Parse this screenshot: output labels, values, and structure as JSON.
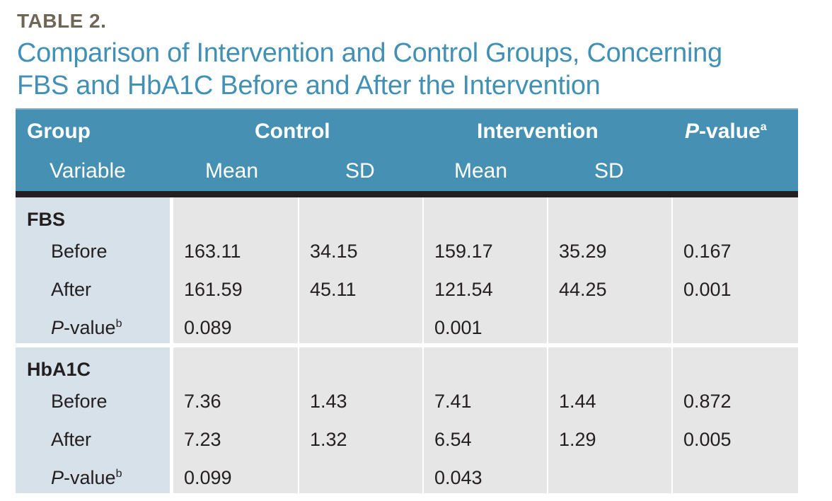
{
  "table_label": "TABLE 2.",
  "title": "Comparison of Intervention and Control Groups, Concerning FBS and HbA1C Before and After the Intervention",
  "header": {
    "group": "Group",
    "control": "Control",
    "intervention": "Intervention",
    "pvalue_prefix": "P",
    "pvalue_suffix": "-value",
    "pvalue_sup": "a",
    "variable": "Variable",
    "mean1": "Mean",
    "sd1": "SD",
    "mean2": "Mean",
    "sd2": "SD"
  },
  "sections": [
    {
      "name": "FBS",
      "rows": [
        {
          "label": "Before",
          "c_mean": "163.11",
          "c_sd": "34.15",
          "i_mean": "159.17",
          "i_sd": "35.29",
          "p": "0.167"
        },
        {
          "label": "After",
          "c_mean": "161.59",
          "c_sd": "45.11",
          "i_mean": "121.54",
          "i_sd": "44.25",
          "p": "0.001"
        },
        {
          "label_prefix": "P",
          "label_suffix": "-value",
          "label_sup": "b",
          "c_mean": "0.089",
          "c_sd": "",
          "i_mean": "0.001",
          "i_sd": "",
          "p": ""
        }
      ]
    },
    {
      "name": "HbA1C",
      "rows": [
        {
          "label": "Before",
          "c_mean": "7.36",
          "c_sd": "1.43",
          "i_mean": "7.41",
          "i_sd": "1.44",
          "p": "0.872"
        },
        {
          "label": "After",
          "c_mean": "7.23",
          "c_sd": "1.32",
          "i_mean": "6.54",
          "i_sd": "1.29",
          "p": "0.005"
        },
        {
          "label_prefix": "P",
          "label_suffix": "-value",
          "label_sup": "b",
          "c_mean": "0.099",
          "c_sd": "",
          "i_mean": "0.043",
          "i_sd": "",
          "p": ""
        }
      ]
    }
  ],
  "colors": {
    "header": "#4590b3",
    "title": "#4291b5",
    "label_bg": "#d7e1ea",
    "value_bg": "#e6e6e6"
  }
}
